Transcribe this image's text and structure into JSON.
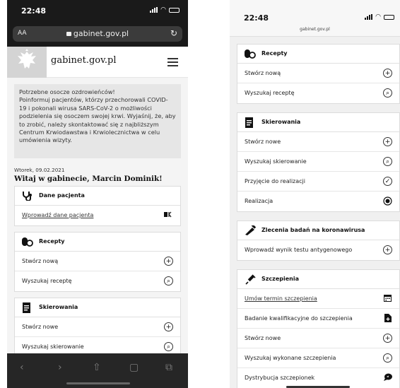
{
  "status_bar": {
    "time": "22:48"
  },
  "browser": {
    "font_size_label": "AA",
    "url": "gabinet.gov.pl",
    "reload_symbol": "↻"
  },
  "site": {
    "name": "gabinet.gov.pl"
  },
  "alert": {
    "lines": [
      "Potrzebne osocze ozdrowieńców!",
      "Poinformuj pacjentów, którzy przechorowali COVID-",
      "19 i pokonali wirusa SARS-CoV-2 o możliwości",
      "podzielenia się osoczem swojej krwi. Wyjaśnij, że, aby",
      "to zrobić, należy skontaktować się z najbliższym",
      "Centrum Krwiodawstwa i Krwiolecznictwa w celu",
      "umówienia wizyty."
    ]
  },
  "greeting": {
    "date": "Wtorek, 09.02.2021",
    "text": "Witaj w gabinecie, Marcin Dominik!"
  },
  "sections": {
    "patient": {
      "title": "Dane pacjenta",
      "items": [
        "Wprowadź dane pacjenta"
      ]
    },
    "prescriptions": {
      "title": "Recepty",
      "items": [
        "Stwórz nową",
        "Wyszukaj receptę"
      ]
    },
    "referrals": {
      "title": "Skierowania",
      "items": [
        "Stwórz nowe",
        "Wyszukaj skierowanie",
        "Przyjęcie do realizacji",
        "Realizacja"
      ]
    },
    "covid_tests": {
      "title": "Zlecenia badań na koronawirusa",
      "items": [
        "Wprowadź wynik testu antygenowego"
      ]
    },
    "vaccinations": {
      "title": "Szczepienia",
      "items": [
        "Umów termin szczepienia",
        "Badanie kwalifikacyjne do szczepienia",
        "Stwórz nowe",
        "Wyszukaj wykonane szczepienia",
        "Dystrybucja szczepionek"
      ]
    }
  },
  "icons": {
    "safari_back": "‹",
    "safari_forward": "›",
    "share": "⇧",
    "bookmarks": "▢",
    "tabs": "⧉",
    "plus": "+",
    "search": "⌕",
    "check": "✓"
  }
}
